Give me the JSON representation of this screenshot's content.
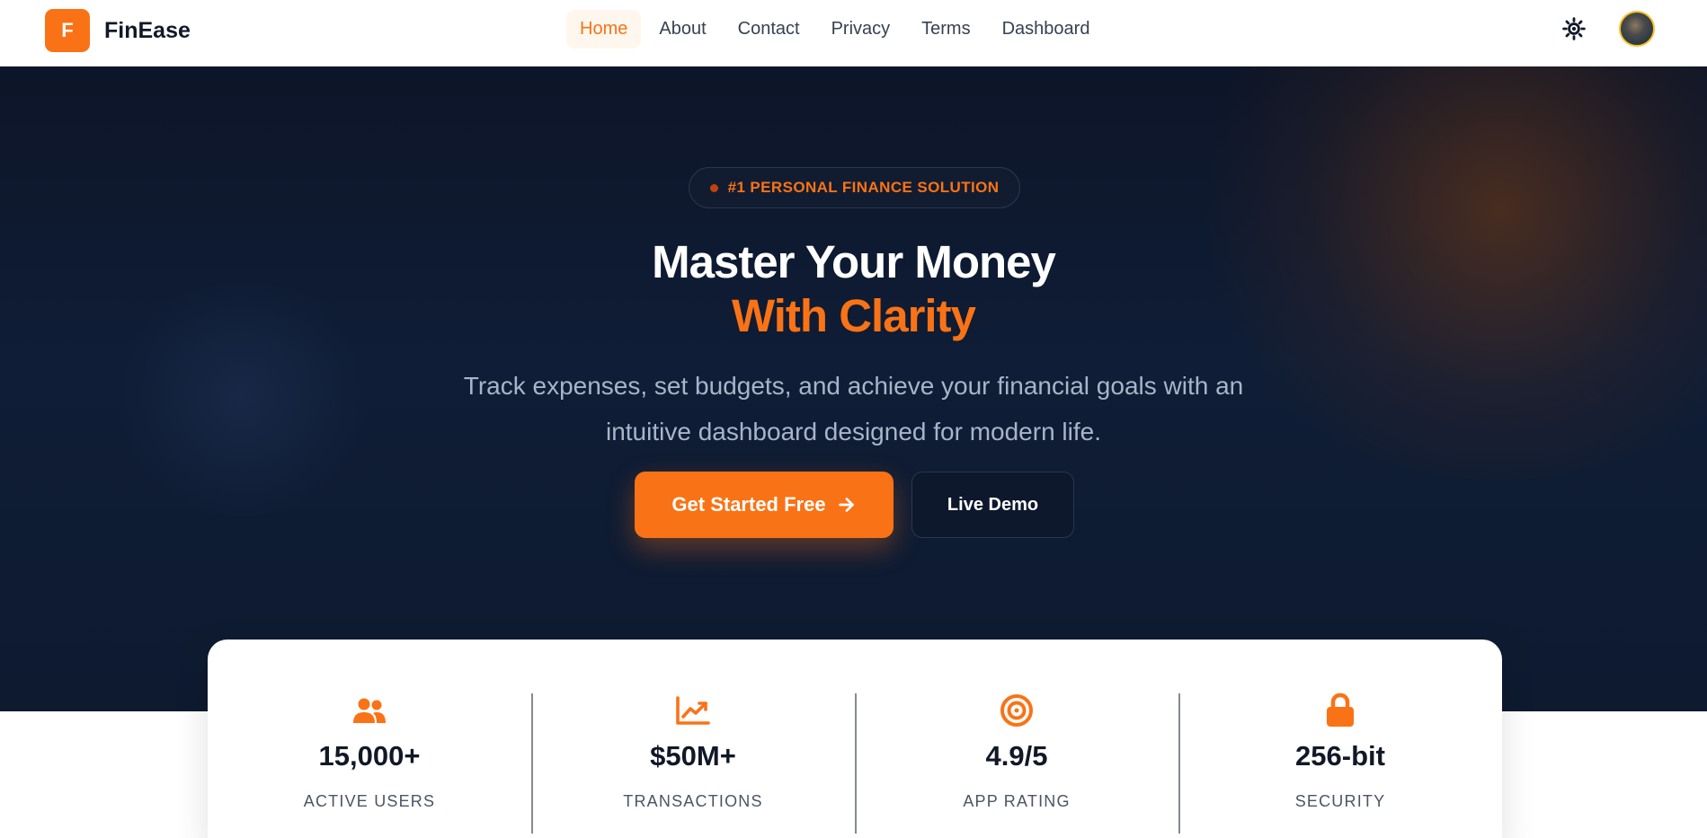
{
  "brand": {
    "logo_letter": "F",
    "name": "FinEase"
  },
  "nav": {
    "links": [
      {
        "label": "Home",
        "active": true
      },
      {
        "label": "About"
      },
      {
        "label": "Contact"
      },
      {
        "label": "Privacy"
      },
      {
        "label": "Terms"
      },
      {
        "label": "Dashboard"
      }
    ],
    "theme_toggle_icon": "sun-icon",
    "avatar": "user-avatar"
  },
  "hero": {
    "badge": "#1 PERSONAL FINANCE SOLUTION",
    "title_line1": "Master Your Money",
    "title_line2": "With Clarity",
    "subtitle": "Track expenses, set budgets, and achieve your financial goals with an intuitive dashboard designed for modern life.",
    "cta_primary": "Get Started Free",
    "cta_secondary": "Live Demo"
  },
  "stats": [
    {
      "icon": "users-icon",
      "value": "15,000+",
      "label": "ACTIVE USERS"
    },
    {
      "icon": "chart-line-icon",
      "value": "$50M+",
      "label": "TRANSACTIONS"
    },
    {
      "icon": "target-icon",
      "value": "4.9/5",
      "label": "APP RATING"
    },
    {
      "icon": "lock-icon",
      "value": "256-bit",
      "label": "SECURITY"
    }
  ],
  "colors": {
    "accent": "#f97316",
    "hero_bg": "#0f1d36",
    "text_dark": "#111827"
  }
}
